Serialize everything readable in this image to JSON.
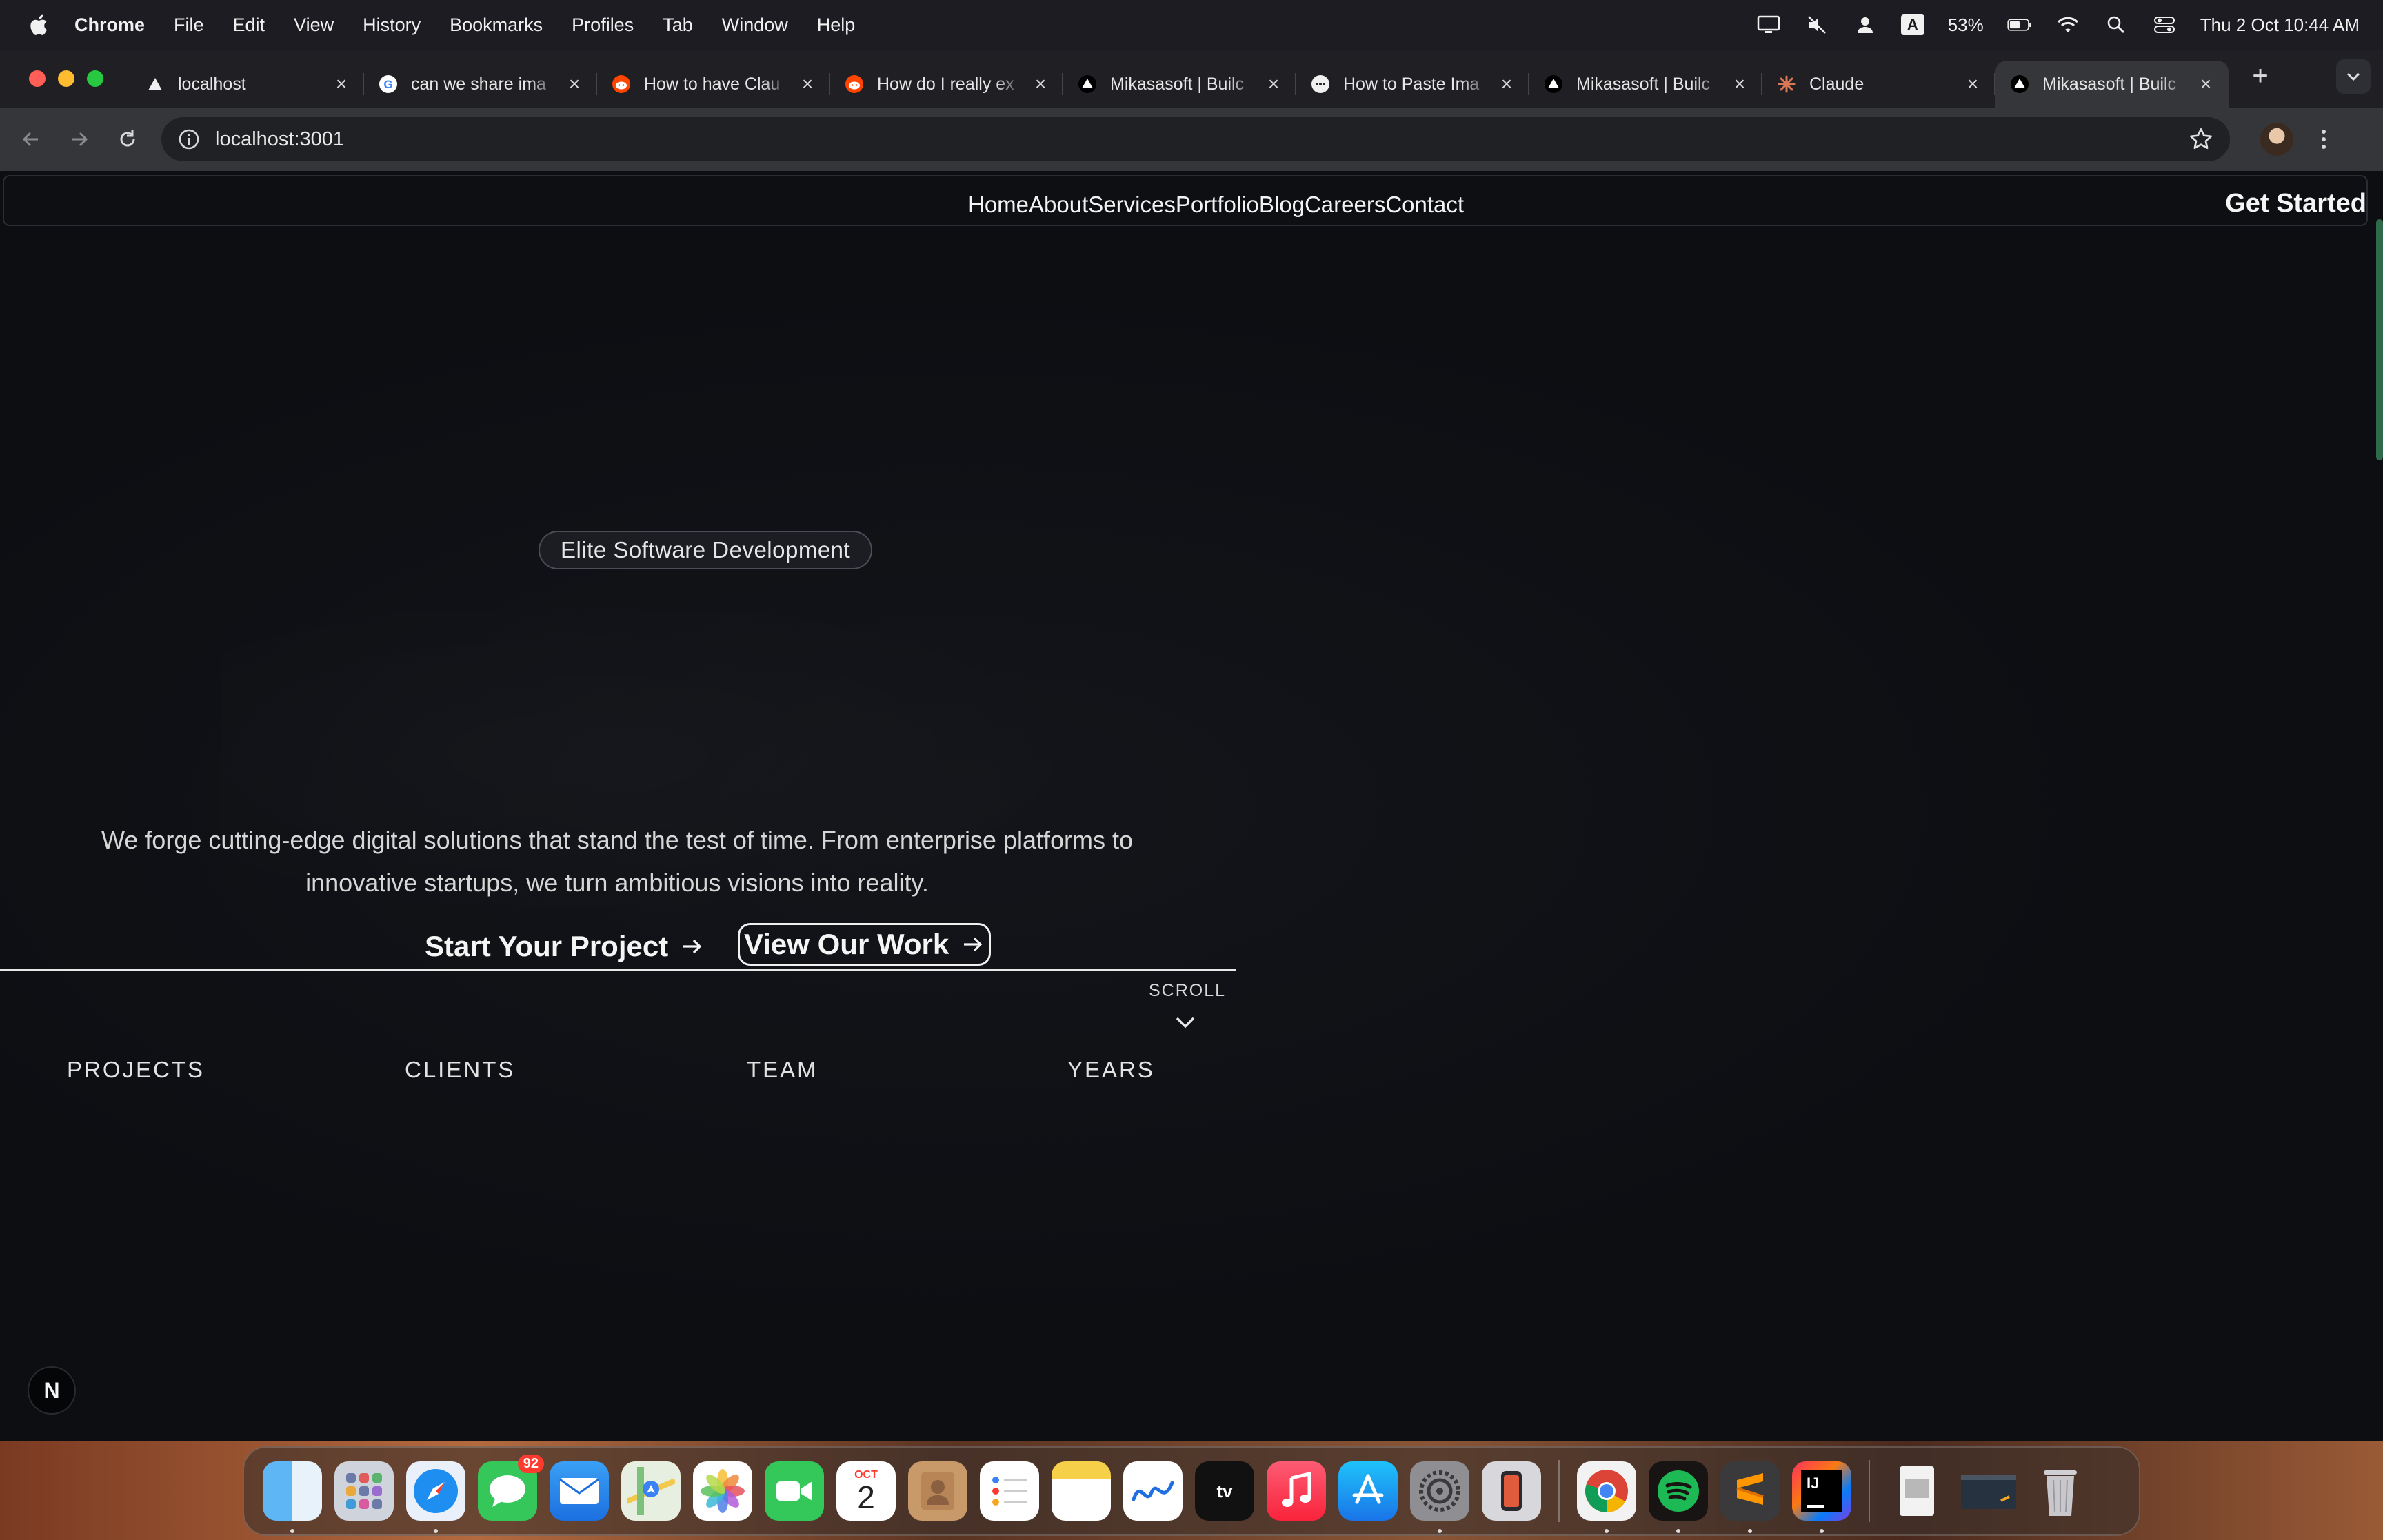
{
  "menubar": {
    "app_name": "Chrome",
    "menus": [
      "File",
      "Edit",
      "View",
      "History",
      "Bookmarks",
      "Profiles",
      "Tab",
      "Window",
      "Help"
    ],
    "input_source": "A",
    "battery": "53%",
    "datetime": "Thu 2 Oct  10:44 AM"
  },
  "tabs": [
    {
      "title": "localhost",
      "favicon": "triangle-icon"
    },
    {
      "title": "can we share ima",
      "favicon": "google-icon"
    },
    {
      "title": "How to have Clau",
      "favicon": "reddit-icon"
    },
    {
      "title": "How do I really ex",
      "favicon": "reddit-icon"
    },
    {
      "title": "Mikasasoft | Builc",
      "favicon": "triangle-icon"
    },
    {
      "title": "How to Paste Ima",
      "favicon": "chat-icon"
    },
    {
      "title": "Mikasasoft | Builc",
      "favicon": "triangle-icon"
    },
    {
      "title": "Claude",
      "favicon": "claude-icon"
    },
    {
      "title": "Mikasasoft | Builc",
      "favicon": "triangle-icon",
      "active": true
    }
  ],
  "toolbar": {
    "url": "localhost:3001"
  },
  "site": {
    "nav": {
      "links": [
        "Home",
        "About",
        "Services",
        "Portfolio",
        "Blog",
        "Careers",
        "Contact"
      ],
      "cta": "Get Started"
    },
    "hero": {
      "badge": "Elite Software Development",
      "subtitle_line1": "We forge cutting-edge digital solutions that stand the test of time. From enterprise platforms to",
      "subtitle_line2": "innovative startups, we turn ambitious visions into reality.",
      "primary_cta": "Start Your Project",
      "secondary_cta": "View Our Work",
      "scroll_label": "SCROLL"
    },
    "stats": [
      "PROJECTS",
      "CLIENTS",
      "TEAM",
      "YEARS"
    ],
    "dev_badge": "N"
  },
  "dock": {
    "messages_badge": "92",
    "calendar_month": "OCT",
    "calendar_day": "2",
    "apps": [
      "finder",
      "launchpad",
      "safari",
      "messages",
      "mail",
      "maps",
      "photos",
      "facetime",
      "calendar",
      "contacts",
      "reminders",
      "notes",
      "freeform",
      "tv",
      "music",
      "app-store",
      "system-settings",
      "iphone-mirroring",
      "chrome",
      "spotify",
      "sublime-text",
      "intellij",
      "preview",
      "terminal-window",
      "trash"
    ]
  },
  "colors": {
    "page_bg": "#0c0e12",
    "accent_scrollbar": "#2f6b4a"
  }
}
